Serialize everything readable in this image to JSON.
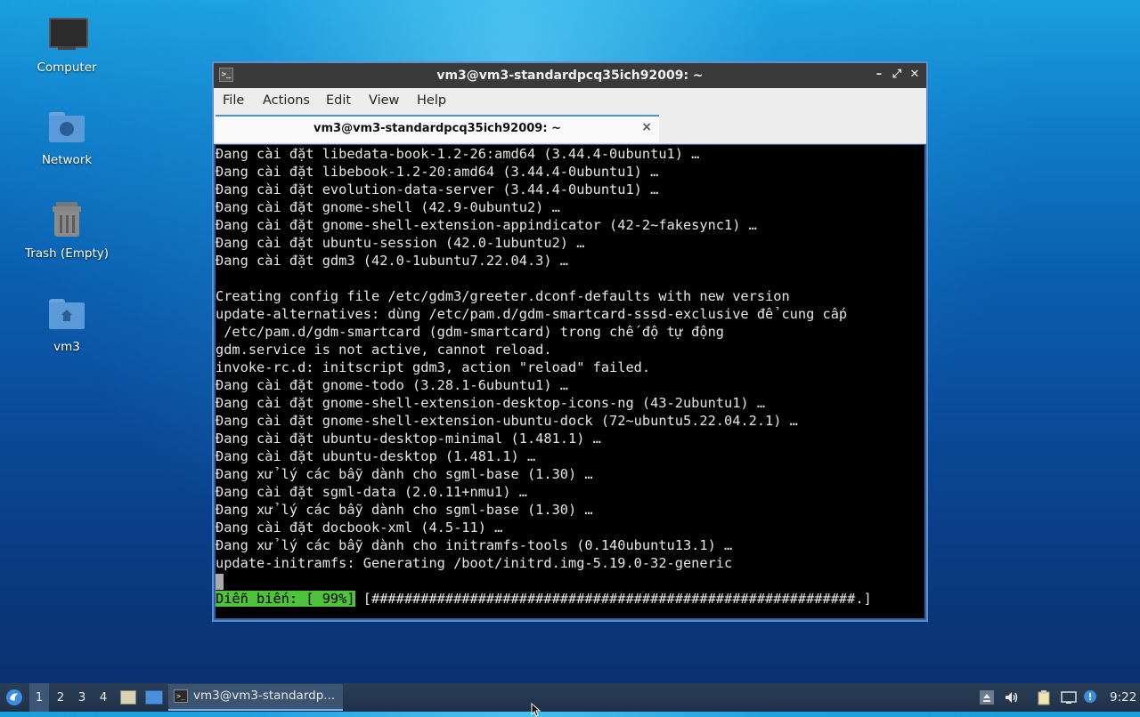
{
  "desktop": {
    "icons": [
      {
        "label": "Computer",
        "icon": "computer-icon"
      },
      {
        "label": "Network",
        "icon": "network-folder-icon"
      },
      {
        "label": "Trash (Empty)",
        "icon": "trash-icon"
      },
      {
        "label": "vm3",
        "icon": "home-folder-icon"
      }
    ]
  },
  "window": {
    "title": "vm3@vm3-standardpcq35ich92009: ~",
    "menu": [
      "File",
      "Actions",
      "Edit",
      "View",
      "Help"
    ],
    "tab": {
      "label": "vm3@vm3-standardpcq35ich92009: ~",
      "close": "×"
    }
  },
  "terminal": {
    "lines": [
      "Đang cài đặt libedata-book-1.2-26:amd64 (3.44.4-0ubuntu1) …",
      "Đang cài đặt libebook-1.2-20:amd64 (3.44.4-0ubuntu1) …",
      "Đang cài đặt evolution-data-server (3.44.4-0ubuntu1) …",
      "Đang cài đặt gnome-shell (42.9-0ubuntu2) …",
      "Đang cài đặt gnome-shell-extension-appindicator (42-2~fakesync1) …",
      "Đang cài đặt ubuntu-session (42.0-1ubuntu2) …",
      "Đang cài đặt gdm3 (42.0-1ubuntu7.22.04.3) …",
      "",
      "Creating config file /etc/gdm3/greeter.dconf-defaults with new version",
      "update-alternatives: dùng /etc/pam.d/gdm-smartcard-sssd-exclusive để cung cấp",
      " /etc/pam.d/gdm-smartcard (gdm-smartcard) trong chế độ tự động",
      "gdm.service is not active, cannot reload.",
      "invoke-rc.d: initscript gdm3, action \"reload\" failed.",
      "Đang cài đặt gnome-todo (3.28.1-6ubuntu1) …",
      "Đang cài đặt gnome-shell-extension-desktop-icons-ng (43-2ubuntu1) …",
      "Đang cài đặt gnome-shell-extension-ubuntu-dock (72~ubuntu5.22.04.2.1) …",
      "Đang cài đặt ubuntu-desktop-minimal (1.481.1) …",
      "Đang cài đặt ubuntu-desktop (1.481.1) …",
      "Đang xử lý các bẫy dành cho sgml-base (1.30) …",
      "Đang cài đặt sgml-data (2.0.11+nmu1) …",
      "Đang xử lý các bẫy dành cho sgml-base (1.30) …",
      "Đang cài đặt docbook-xml (4.5-11) …",
      "Đang xử lý các bẫy dành cho initramfs-tools (0.140ubuntu13.1) …",
      "update-initramfs: Generating /boot/initrd.img-5.19.0-32-generic"
    ],
    "progress": {
      "label": "Diễn biến: [ 99%]",
      "bar": " [###########################################################.]",
      "percent": 99
    }
  },
  "taskbar": {
    "workspaces": [
      "1",
      "2",
      "3",
      "4"
    ],
    "active_workspace": "1",
    "task_label": "vm3@vm3-standardp...",
    "clock": "9:22",
    "colors": {
      "panel": "#1e3148",
      "accent": "#7fb3ef",
      "progress": "#4ec23a"
    }
  }
}
